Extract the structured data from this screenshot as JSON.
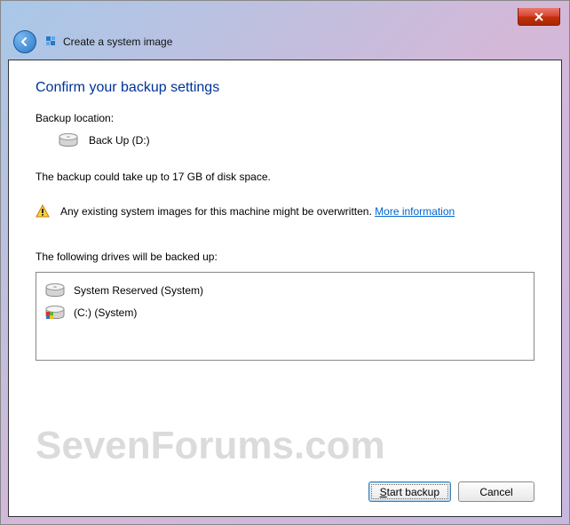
{
  "titlebar": {
    "title": "Create a system image"
  },
  "page": {
    "heading": "Confirm your backup settings",
    "backup_location_label": "Backup location:",
    "backup_location_value": "Back Up (D:)",
    "estimate_text": "The backup could take up to 17 GB of disk space.",
    "warning_text": "Any existing system images for this machine might be overwritten.",
    "warning_link": "More information",
    "drives_label": "The following drives will be backed up:",
    "drives": [
      {
        "label": "System Reserved (System)",
        "icon": "drive"
      },
      {
        "label": "(C:) (System)",
        "icon": "system-drive"
      }
    ]
  },
  "footer": {
    "start_label": "Start backup",
    "cancel_label": "Cancel"
  },
  "watermark": "SevenForums.com"
}
